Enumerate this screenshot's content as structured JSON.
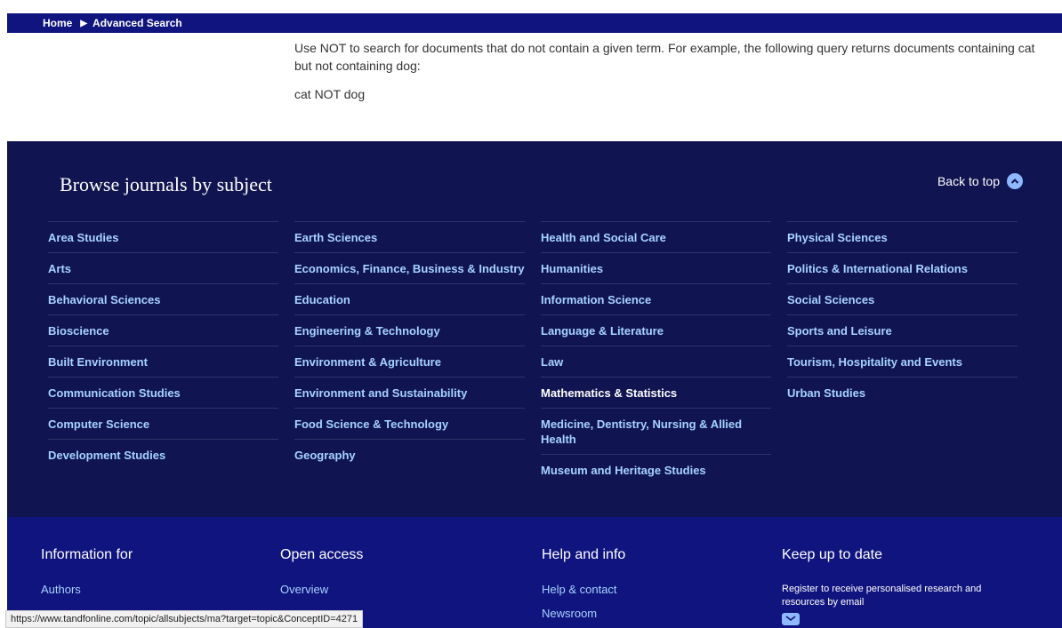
{
  "breadcrumb": {
    "home": "Home",
    "current": "Advanced Search"
  },
  "help": {
    "paragraph": "Use NOT to search for documents that do not contain a given term. For example, the following query returns documents containing cat but not containing dog:",
    "example": "cat NOT dog"
  },
  "browse": {
    "title": "Browse journals by subject",
    "back_to_top": "Back to top",
    "columns": [
      [
        "Area Studies",
        "Arts",
        "Behavioral Sciences",
        "Bioscience",
        "Built Environment",
        "Communication Studies",
        "Computer Science",
        "Development Studies"
      ],
      [
        "Earth Sciences",
        "Economics, Finance, Business & Industry",
        "Education",
        "Engineering & Technology",
        "Environment & Agriculture",
        "Environment and Sustainability",
        "Food Science & Technology",
        "Geography"
      ],
      [
        "Health and Social Care",
        "Humanities",
        "Information Science",
        "Language & Literature",
        "Law",
        "Mathematics & Statistics",
        "Medicine, Dentistry, Nursing & Allied Health",
        "Museum and Heritage Studies"
      ],
      [
        "Physical Sciences",
        "Politics & International Relations",
        "Social Sciences",
        "Sports and Leisure",
        "Tourism, Hospitality and Events",
        "Urban Studies"
      ]
    ],
    "highlighted": "Mathematics & Statistics"
  },
  "footer": {
    "info_for": {
      "heading": "Information for",
      "links": [
        "Authors"
      ]
    },
    "open_access": {
      "heading": "Open access",
      "links": [
        "Overview"
      ]
    },
    "help_info": {
      "heading": "Help and info",
      "links": [
        "Help & contact",
        "Newsroom"
      ]
    },
    "keep_up": {
      "heading": "Keep up to date",
      "note": "Register to receive personalised research and resources by email"
    }
  },
  "status_url": "https://www.tandfonline.com/topic/allsubjects/ma?target=topic&ConceptID=4271",
  "colors": {
    "nav_bar": "#10147e",
    "browse_bg": "#101450",
    "link": "#a7d3ff"
  },
  "icons": {
    "back_to_top": "chevron-up-icon",
    "email": "envelope-icon",
    "breadcrumb_separator": "triangle-right-icon"
  }
}
